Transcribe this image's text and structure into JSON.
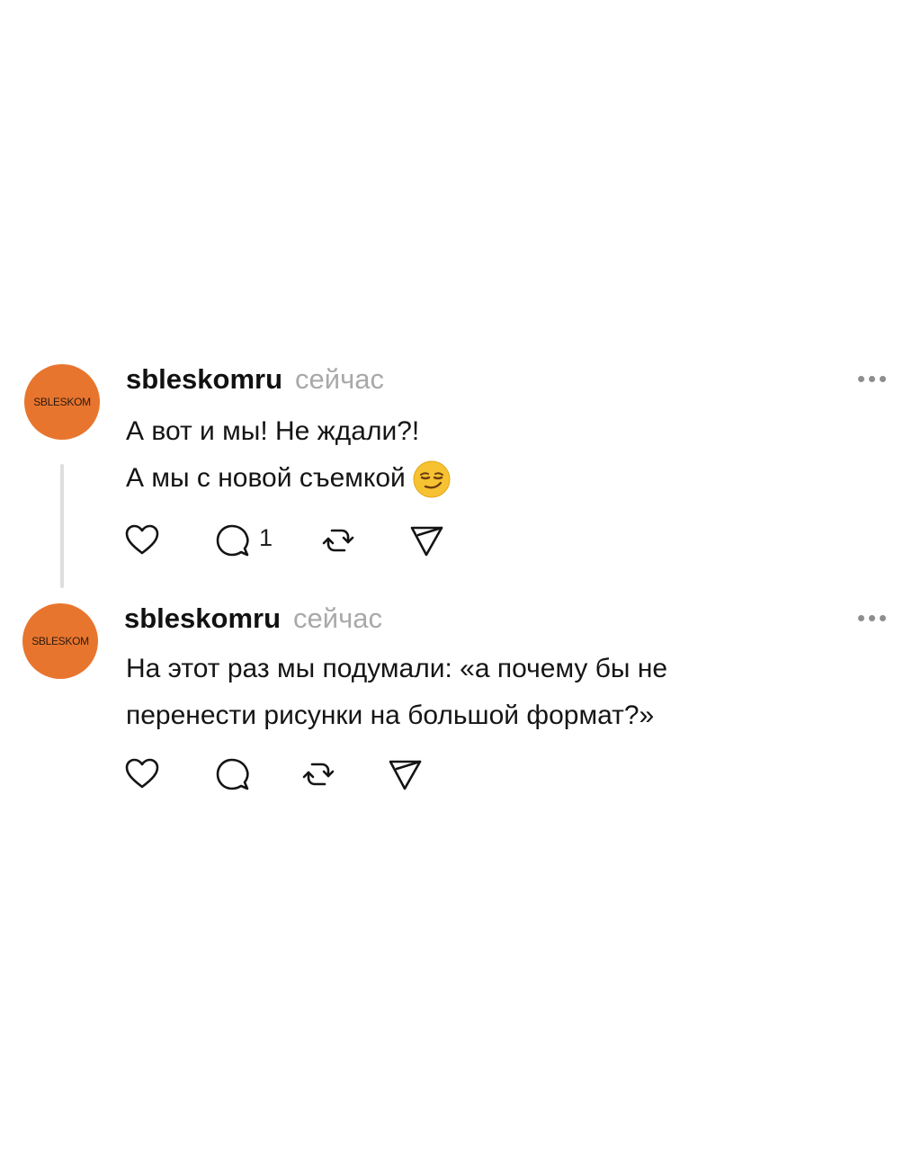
{
  "posts": [
    {
      "avatar_label": "SBLESKOM",
      "username": "sbleskomru",
      "timestamp": "сейчас",
      "text_lines": [
        "А вот и мы! Не ждали?!",
        "А мы с новой съемкой"
      ],
      "emoji": "smirking-face",
      "reply_count": "1"
    },
    {
      "avatar_label": "SBLESKOM",
      "username": "sbleskomru",
      "timestamp": "сейчас",
      "text_lines": [
        "На этот раз мы подумали: «а почему бы не",
        "перенести рисунки на большой формат?»"
      ],
      "reply_count": ""
    }
  ],
  "icons": [
    "heart-icon",
    "comment-icon",
    "repost-icon",
    "share-icon",
    "more-icon"
  ],
  "colors": {
    "avatar_bg": "#e8752e",
    "timestamp": "#a9a9a9",
    "thread_line": "#dedede"
  }
}
